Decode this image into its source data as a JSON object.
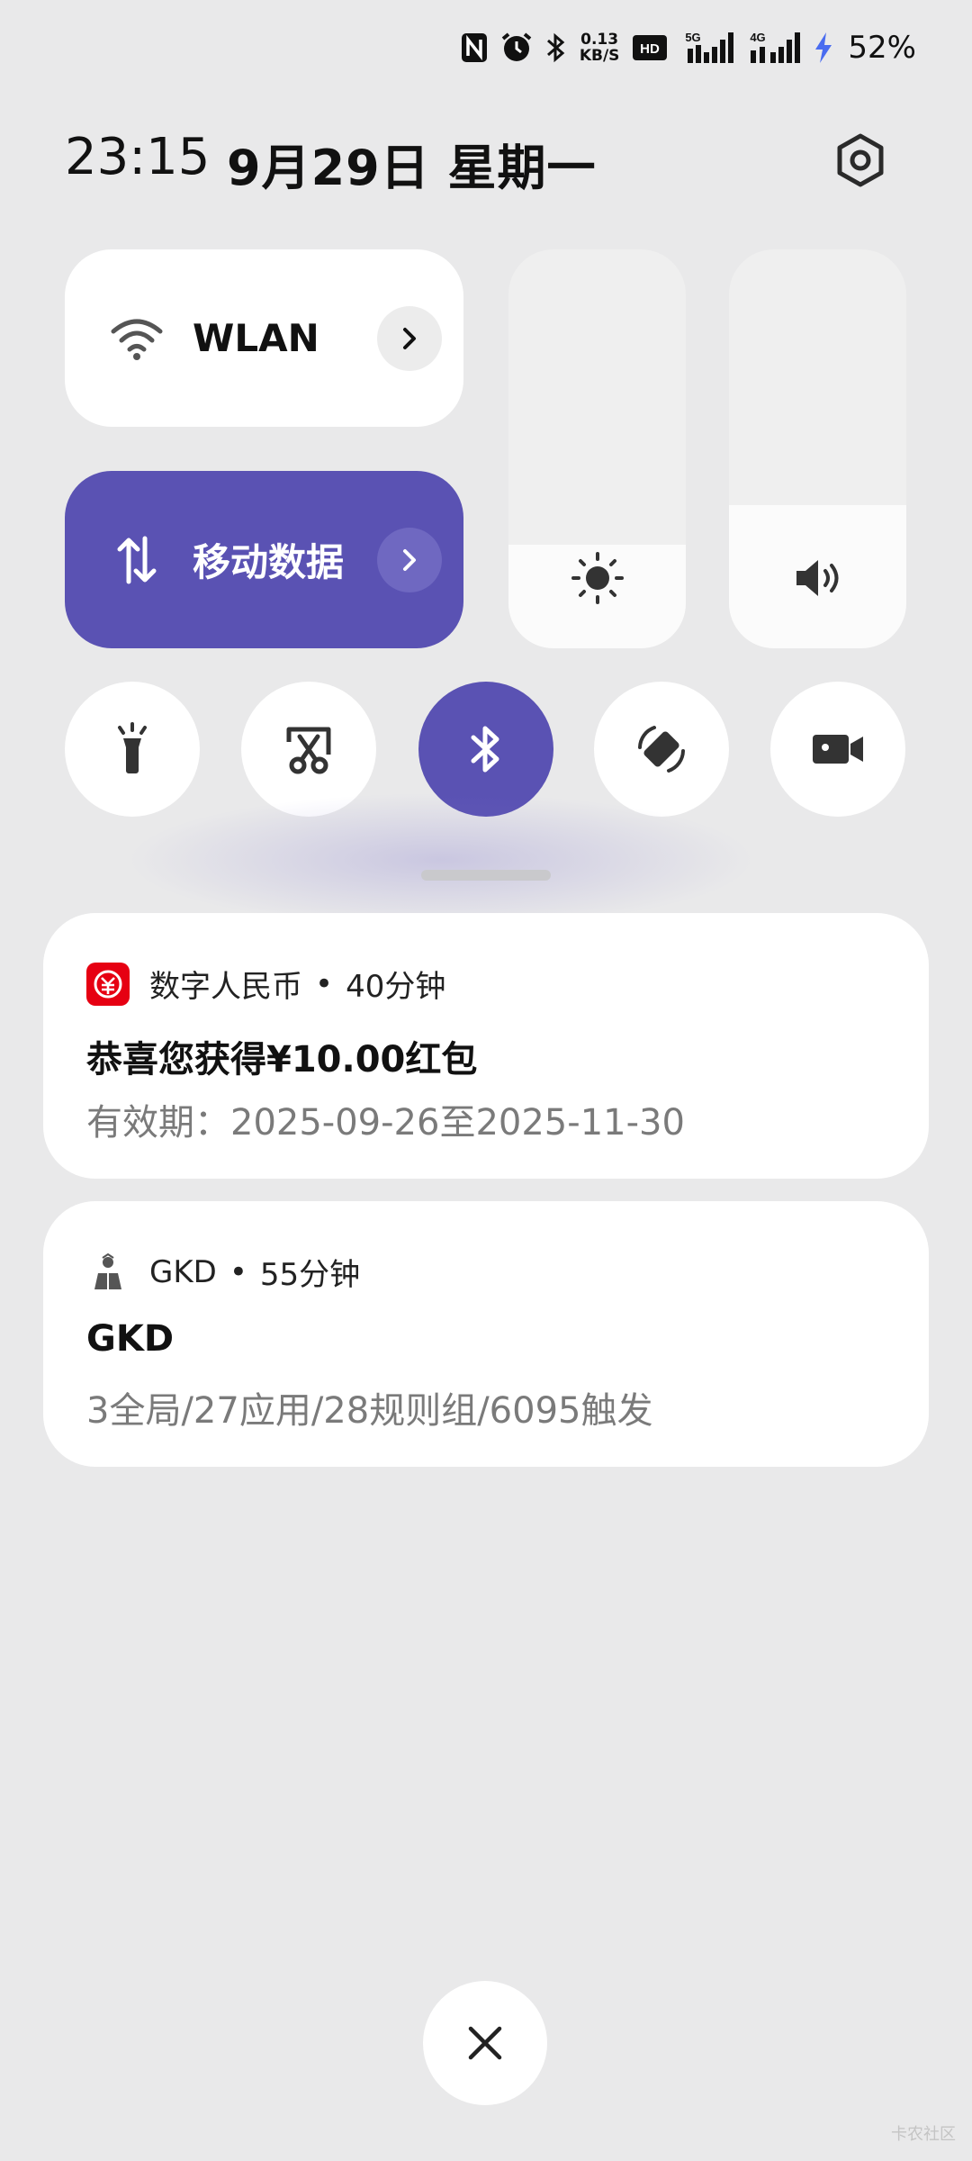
{
  "status_bar": {
    "net_speed_value": "0.13",
    "net_speed_unit": "KB/S",
    "hd_badge": "HD",
    "signal_1_label": "5G",
    "signal_2_label": "4G",
    "battery": "52%",
    "icons": [
      "nfc-icon",
      "alarm-icon",
      "bluetooth-icon",
      "net-speed",
      "hd-voice-icon",
      "signal-5g-icon",
      "signal-4g-icon",
      "charging-icon"
    ]
  },
  "header": {
    "time": "23:15",
    "date": "9月29日 星期一"
  },
  "tiles": {
    "wlan": {
      "label": "WLAN",
      "icon": "wifi-icon"
    },
    "mobile_data": {
      "label": "移动数据",
      "icon": "data-arrows-icon",
      "active_color": "#5a52b3"
    }
  },
  "sliders": {
    "brightness": {
      "icon": "sun-icon",
      "level": 0.26
    },
    "volume": {
      "icon": "speaker-icon",
      "level": 0.36
    }
  },
  "toggles": [
    {
      "name": "flashlight",
      "icon": "flashlight-icon",
      "active": false
    },
    {
      "name": "screenshot",
      "icon": "screenshot-scissors-icon",
      "active": false
    },
    {
      "name": "bluetooth",
      "icon": "bluetooth-icon",
      "active": true
    },
    {
      "name": "auto-rotate",
      "icon": "rotate-icon",
      "active": false
    },
    {
      "name": "screen-record",
      "icon": "video-camera-icon",
      "active": false
    }
  ],
  "notifications": [
    {
      "app": "数字人民币",
      "time": "40分钟",
      "title": "恭喜您获得¥10.00红包",
      "body": "有效期：2025-09-26至2025-11-30",
      "icon_color": "#e60012"
    },
    {
      "app": "GKD",
      "time": "55分钟",
      "title": "GKD",
      "body": "3全局/27应用/28规则组/6095触发"
    }
  ],
  "separator": "•",
  "watermark": "卡农社区"
}
